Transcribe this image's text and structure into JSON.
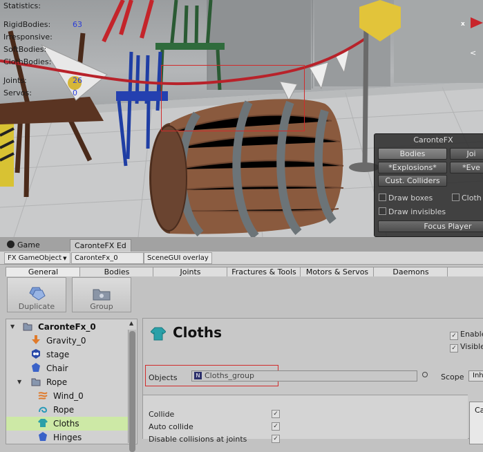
{
  "scene": {
    "stats": [
      {
        "label": "Statistics:",
        "value": ""
      },
      {
        "label": "RigidBodies:",
        "value": "63"
      },
      {
        "label": "Irresponsive:",
        "value": ""
      },
      {
        "label": "SoftBodies:",
        "value": ""
      },
      {
        "label": "ClothBodies:",
        "value": ""
      },
      {
        "label": "Joints:",
        "value": "26"
      },
      {
        "label": "Servos:",
        "value": "0"
      }
    ],
    "overlay": {
      "title": "CaronteFX",
      "bodies_btn": "Bodies",
      "joints_btn": "Joi",
      "explosions_btn": "*Explosions*",
      "events_btn": "*Eve",
      "cust_colliders_btn": "Cust. Colliders",
      "draw_boxes_label": "Draw boxes",
      "cloth_label": "Cloth",
      "draw_invisibles_label": "Draw invisibles",
      "focus_player_btn": "Focus Player"
    },
    "x_label": "x",
    "p_label": "<"
  },
  "tabs": {
    "game": "Game",
    "carontefx": "CaronteFX Ed"
  },
  "toolbar": {
    "fx_gameobject": "FX GameObject",
    "object_name": "CaronteFx_0",
    "scenegui": "SceneGUI overlay"
  },
  "main_tabs": [
    "General",
    "Bodies",
    "Joints",
    "Fractures & Tools",
    "Motors & Servos",
    "Daemons",
    ""
  ],
  "actions": {
    "duplicate": "Duplicate",
    "group": "Group"
  },
  "tree": {
    "root": "CaronteFx_0",
    "gravity": "Gravity_0",
    "stage": "stage",
    "chair": "Chair",
    "rope_group": "Rope",
    "wind": "Wind_0",
    "rope": "Rope",
    "cloths": "Cloths",
    "hinges": "Hinges"
  },
  "detail": {
    "title": "Cloths",
    "enabled_label": "Enable",
    "visible_label": "Visible",
    "objects_label": "Objects",
    "objects_value": "Cloths_group",
    "scope_label": "Scope",
    "scope_value": "Inh",
    "collide_label": "Collide",
    "auto_collide_label": "Auto collide",
    "disable_collisions_label": "Disable collisions at joints",
    "side_card_label": "Ca"
  },
  "colors": {
    "selection_red": "#d12a2a",
    "tree_selected": "#cde9a6",
    "stats_value_blue": "#2a3cd8",
    "cloth_teal": "#2aa0a8"
  }
}
